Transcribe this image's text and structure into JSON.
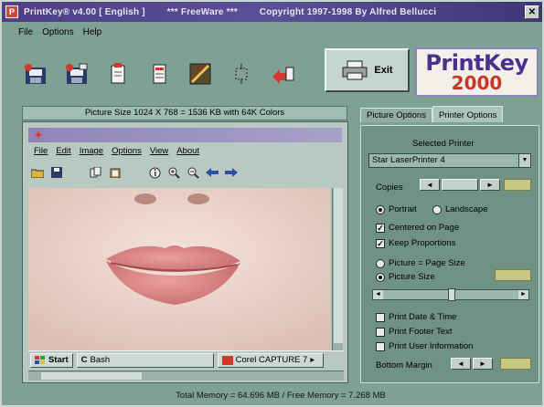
{
  "window": {
    "title": "PrintKey® v4.00 [ English ]        *** FreeWare ***        Copyright 1997-1998 By Alfred Bellucci",
    "close_glyph": "✕"
  },
  "menu": [
    "File",
    "Options",
    "Help"
  ],
  "toolbar": {
    "exit_label": "Exit"
  },
  "logo": {
    "line1": "PrintKey",
    "line2": "2000"
  },
  "picture_info": "Picture Size 1024 X 768 = 1536 KB with 64K Colors",
  "tabs": [
    {
      "label": "Picture Options",
      "active": false
    },
    {
      "label": "Printer Options",
      "active": true
    }
  ],
  "printer_options": {
    "selected_printer_label": "Selected Printer",
    "printer_value": "Star LaserPrinter 4",
    "copies_label": "Copies",
    "orientation": [
      {
        "label": "Portrait",
        "selected": true
      },
      {
        "label": "Landscape",
        "selected": false
      }
    ],
    "centered_label": "Centered on Page",
    "centered_checked": true,
    "keep_prop_label": "Keep Proportions",
    "keep_prop_checked": true,
    "size_options": [
      {
        "label": "Picture = Page Size",
        "selected": false
      },
      {
        "label": "Picture Size",
        "selected": true
      }
    ],
    "print_date_label": "Print Date & Time",
    "print_footer_label": "Print Footer Text",
    "print_user_label": "Print User Information",
    "bottom_margin_label": "Bottom Margin",
    "slider_level": 0.5,
    "spin_left": "◄",
    "spin_right": "►",
    "check_mark": "✓"
  },
  "preview": {
    "menu": [
      "File",
      "Edit",
      "Image",
      "Options",
      "View",
      "About"
    ],
    "taskbar": [
      {
        "label": "Start"
      },
      {
        "label": "Bash"
      },
      {
        "label": "Corel CAPTURE 7"
      }
    ],
    "taskbar_arrow": "▸"
  },
  "status_bar": "Total Memory = 64.696 MB  /  Free Memory = 7.268 MB",
  "colors": {
    "window_bg": "#7fa095",
    "title_bar": "#4e3f86",
    "logo_purple": "#4b2f8d",
    "logo_red": "#c7362b",
    "lips": "#d98a8a"
  }
}
